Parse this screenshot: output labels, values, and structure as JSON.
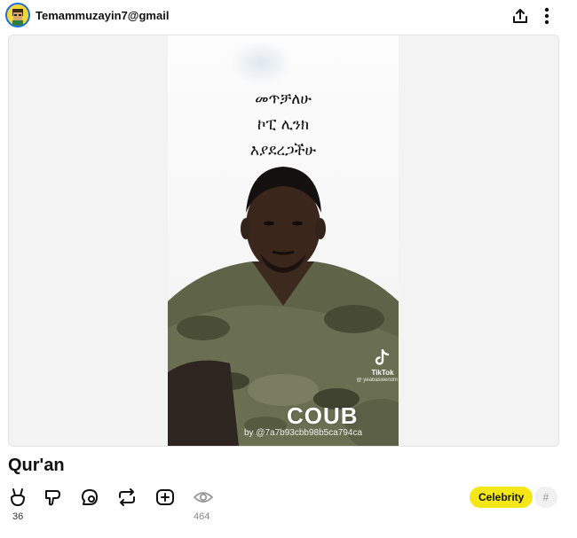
{
  "header": {
    "username": "Temammuzayin7@gmail",
    "share_icon": "share-icon",
    "more_icon": "more-vertical-icon"
  },
  "video": {
    "caption_lines": [
      "መጥቻለሁ",
      "ኮፒ ሊንክ",
      "እያደረጋችሁ"
    ],
    "watermark_app": "TikTok",
    "watermark_handle": "@ yeabaswendm",
    "brand": "COUB",
    "byline": "by @7a7b93cbb98b5ca794ca"
  },
  "post": {
    "title": "Qur'an",
    "likes_count": "36",
    "views_count": "464",
    "tag": "Celebrity",
    "hash": "#"
  },
  "colors": {
    "tag_bg": "#f5e617",
    "avatar_border": "#1e6fd9"
  }
}
